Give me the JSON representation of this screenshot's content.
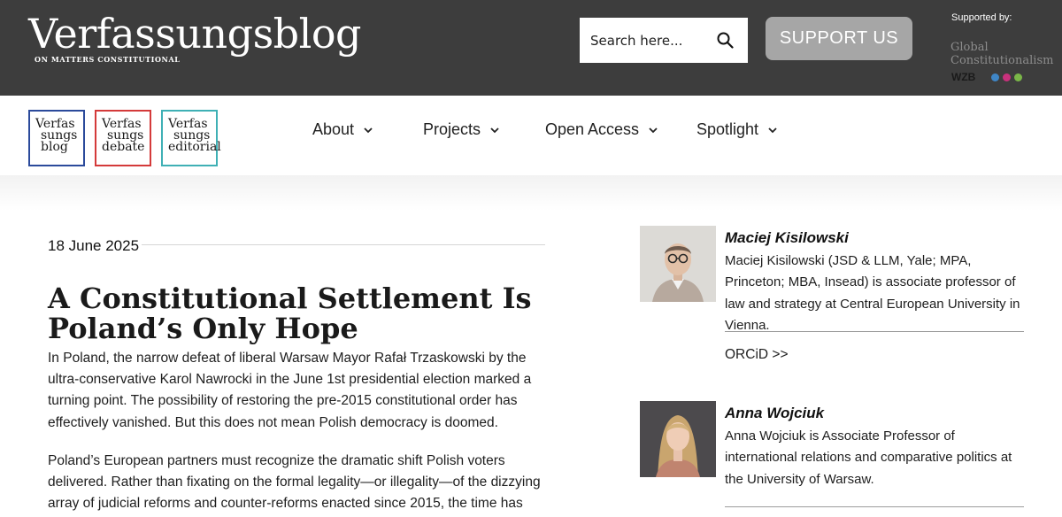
{
  "header": {
    "logo_title": "Verfassungsblog",
    "logo_tagline": "ON MATTERS CONSTITUTIONAL",
    "search_placeholder": "Search here...",
    "support_label": "SUPPORT US",
    "supported_by": "Supported by:",
    "sponsor_line1": "Global",
    "sponsor_line2": "Constitutionalism",
    "sponsor_org": "WZB",
    "sponsor_dot_colors": [
      "#3f86c6",
      "#c8317c",
      "#7ab648"
    ]
  },
  "brands": [
    {
      "line1": "Verfas",
      "line2": "sungs",
      "line3": "blog",
      "color": "#2b4a9b"
    },
    {
      "line1": "Verfas",
      "line2": "sungs",
      "line3": "debate",
      "color": "#d43a3a"
    },
    {
      "line1": "Verfas",
      "line2": "sungs",
      "line3": "editorial",
      "color": "#3fb0b5"
    }
  ],
  "nav": [
    {
      "label": "About"
    },
    {
      "label": "Projects"
    },
    {
      "label": "Open Access"
    },
    {
      "label": "Spotlight"
    }
  ],
  "article": {
    "date": "18 June 2025",
    "title": "A Constitutional Settlement Is Poland’s Only Hope",
    "paragraphs": [
      "In Poland, the narrow defeat of liberal Warsaw Mayor Rafał Trzaskowski by the ultra-conservative Karol Nawrocki in the June 1st presidential election marked a turning point. The possibility of restoring the pre-2015 constitutional order has effectively vanished. But this does not mean Polish democracy is doomed.",
      "Poland’s European partners must recognize the dramatic shift Polish voters delivered. Rather than fixating on the formal legality—or illegality—of the dizzying array of judicial reforms and counter-reforms enacted since 2015, the time has come to"
    ]
  },
  "authors": [
    {
      "name": "Maciej Kisilowski",
      "bio": "Maciej Kisilowski (JSD & LLM, Yale; MPA, Princeton; MBA, Insead) is associate professor of law and strategy at Central European University in Vienna.",
      "link": "ORCiD >>"
    },
    {
      "name": "Anna Wojciuk",
      "bio": "Anna Wojciuk is Associate Professor of international relations and comparative politics at the University of Warsaw."
    }
  ]
}
